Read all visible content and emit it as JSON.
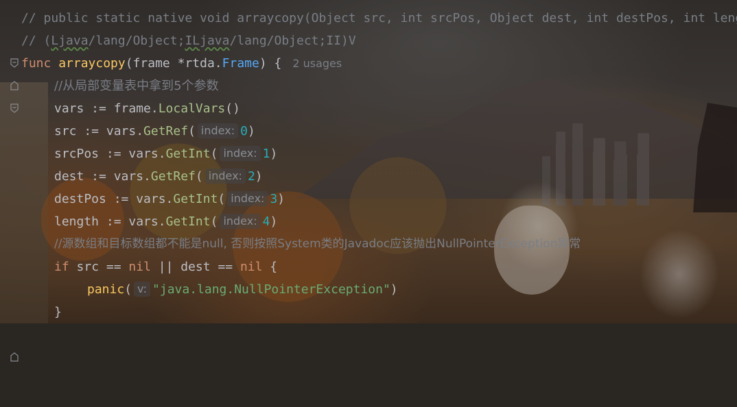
{
  "editor": {
    "lines": {
      "l1": "// public static native void arraycopy(Object src, int srcPos, Object dest, int destPos, int length);",
      "l2_a": "// (",
      "l2_b": "Ljava",
      "l2_c": "/lang/Object;",
      "l2_d": "ILjava",
      "l2_e": "/lang/Object;II)V",
      "l3_kw": "func",
      "l3_name": "arraycopy",
      "l3_paren": "(frame *rtda.",
      "l3_type": "Frame",
      "l3_end": ") {",
      "l3_usages": "2 usages",
      "l4": "//从局部变量表中拿到5个参数",
      "l5_a": "vars := frame.",
      "l5_m": "LocalVars",
      "l5_b": "()",
      "l6_a": "src := vars.",
      "l6_m": "GetRef",
      "l6_p": "(",
      "l6_hint": "index:",
      "l6_n": "0",
      "l6_c": ")",
      "l7_a": "srcPos := vars.",
      "l7_m": "GetInt",
      "l7_p": "(",
      "l7_hint": "index:",
      "l7_n": "1",
      "l7_c": ")",
      "l8_a": "dest := vars.",
      "l8_m": "GetRef",
      "l8_p": "(",
      "l8_hint": "index:",
      "l8_n": "2",
      "l8_c": ")",
      "l9_a": "destPos := vars.",
      "l9_m": "GetInt",
      "l9_p": "(",
      "l9_hint": "index:",
      "l9_n": "3",
      "l9_c": ")",
      "l10_a": "length := vars.",
      "l10_m": "GetInt",
      "l10_p": "(",
      "l10_hint": "index:",
      "l10_n": "4",
      "l10_c": ")",
      "l11": "//源数组和目标数组都不能是null, 否则按照System类的Javadoc应该抛出NullPointerException异常",
      "l12_if": "if",
      "l12_a": " src == ",
      "l12_nil1": "nil",
      "l12_b": " || dest == ",
      "l12_nil2": "nil",
      "l12_c": " {",
      "l13_fn": "panic",
      "l13_p": "(",
      "l13_hint": "v:",
      "l13_str": "\"java.lang.NullPointerException\"",
      "l13_c": ")",
      "l14": "}"
    }
  },
  "colors": {
    "keyword": "#cf8e6d",
    "function": "#fac862",
    "comment": "#7a7e85",
    "type": "#56a8f5",
    "number": "#2aacb8",
    "string": "#6aab73"
  },
  "icons": [
    "fold-marker-icon"
  ]
}
